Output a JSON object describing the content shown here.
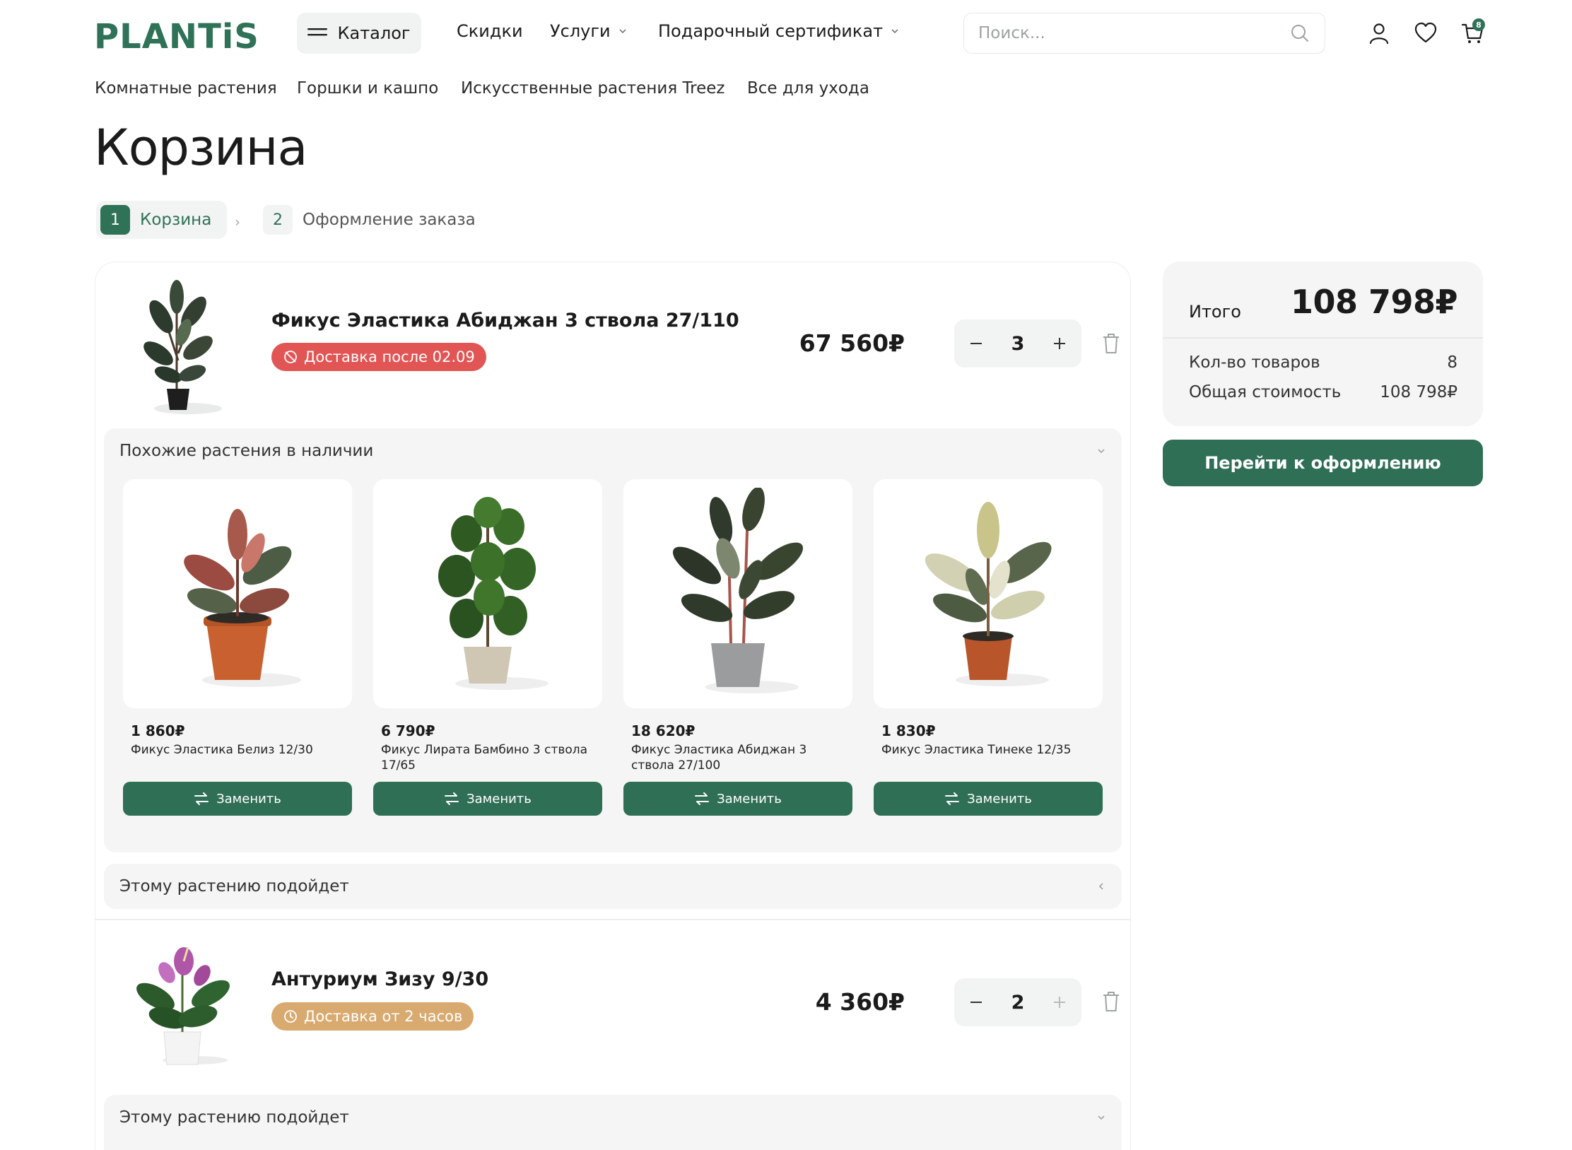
{
  "header": {
    "logo": "PLANTiS",
    "catalog_label": "Каталог",
    "nav": [
      {
        "label": "Скидки",
        "has_dropdown": false
      },
      {
        "label": "Услуги",
        "has_dropdown": true
      },
      {
        "label": "Подарочный сертификат",
        "has_dropdown": true
      }
    ],
    "search_placeholder": "Поиск...",
    "cart_count": "8",
    "icons": [
      "search-icon",
      "user-icon",
      "heart-icon",
      "cart-icon"
    ]
  },
  "subnav": [
    "Комнатные растения",
    "Горшки и кашпо",
    "Искусственные растения Treez",
    "Все для ухода"
  ],
  "page_title": "Корзина",
  "steps": [
    {
      "num": "1",
      "label": "Корзина",
      "active": true
    },
    {
      "num": "2",
      "label": "Оформление заказа",
      "active": false
    }
  ],
  "cart_items": [
    {
      "title": "Фикус Эластика Абиджан 3 ствола 27/110",
      "delivery": "Доставка после 02.09",
      "price": "67 560₽",
      "qty": "3",
      "similar": {
        "title": "Похожие растения в наличии",
        "cards": [
          {
            "price": "1 860₽",
            "name": "Фикус Эластика Белиз 12/30",
            "button": "Заменить"
          },
          {
            "price": "6 790₽",
            "name": "Фикус Лирата Бамбино 3 ствола 17/65",
            "button": "Заменить"
          },
          {
            "price": "18 620₽",
            "name": "Фикус Эластика Абиджан 3 ствола 27/100",
            "button": "Заменить"
          },
          {
            "price": "1 830₽",
            "name": "Фикус Эластика Тинеке 12/35",
            "button": "Заменить"
          }
        ]
      },
      "suits": "Этому растению подойдет"
    },
    {
      "title": "Антуриум Зизу 9/30",
      "delivery": "Доставка от 2 часов",
      "price": "4 360₽",
      "qty": "2",
      "suits": "Этому растению подойдет"
    }
  ],
  "summary": {
    "total_label": "Итого",
    "total_value": "108 798₽",
    "count_label": "Кол-во товаров",
    "count_value": "8",
    "cost_label": "Общая стоимость",
    "cost_value": "108 798₽",
    "checkout": "Перейти к оформлению"
  },
  "colors": {
    "brand": "#2f7257",
    "button": "#2f6f55",
    "badge_red": "#e25555",
    "badge_tan": "#d9aa70"
  }
}
